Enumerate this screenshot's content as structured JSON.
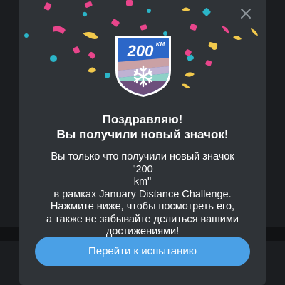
{
  "dialog": {
    "close_icon": "close-icon",
    "badge": {
      "value": "200",
      "unit": "KM",
      "icon": "snowflake-icon",
      "colors": {
        "border": "#2c67c8",
        "sky": "#3f7fe0",
        "stripe1": "#caa1a5",
        "stripe2": "#bfb2d3",
        "stripe3": "#8ed1c7",
        "ground": "#6d4f7c"
      }
    },
    "title_line1": "Поздравляю!",
    "title_line2": "Вы получили новый значок!",
    "description_lines": [
      "Вы только что получили новый значок \"200",
      "km\"",
      "в рамках January Distance Challenge.",
      "Нажмите ниже, чтобы посмотреть его,",
      "а также не забывайте делиться вашими",
      "достижениями!"
    ],
    "cta_label": "Перейти к испытанию"
  },
  "colors": {
    "modal_bg": "#2f3337",
    "cta_bg": "#4aa0e6",
    "confetti": [
      "#f2c94c",
      "#e8458b",
      "#2bb5c8",
      "#3f7fe0"
    ]
  }
}
